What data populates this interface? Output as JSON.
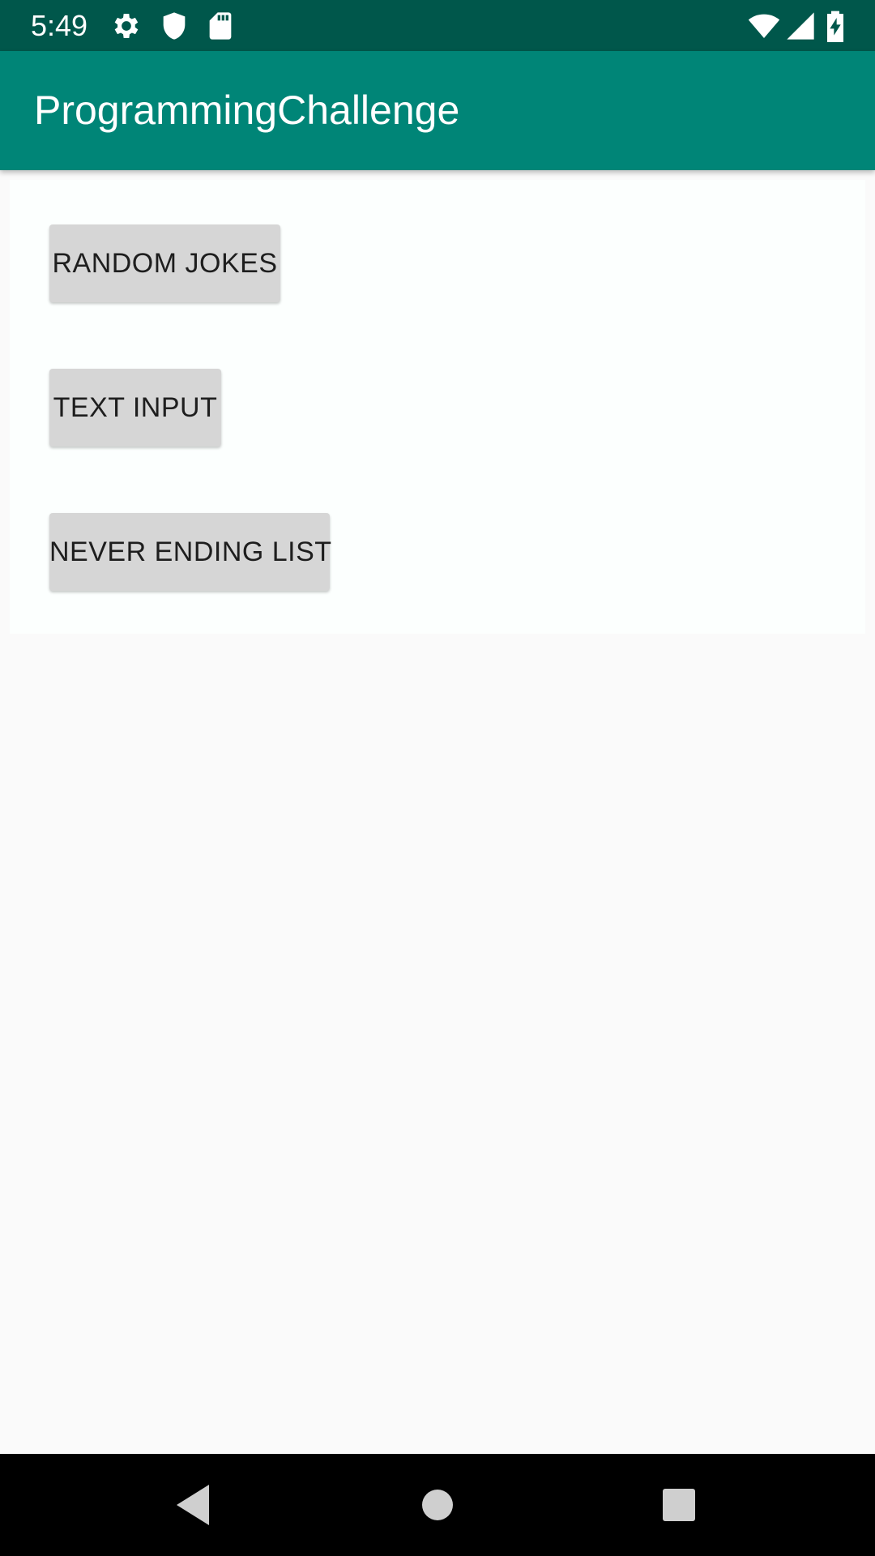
{
  "status_bar": {
    "time": "5:49",
    "left_icons": [
      "gear-icon",
      "shield-icon",
      "sd-card-icon"
    ],
    "right_icons": [
      "wifi-icon",
      "signal-icon",
      "battery-charging-icon"
    ],
    "background": "#00574b"
  },
  "app_bar": {
    "title": "ProgrammingChallenge",
    "background": "#008577"
  },
  "buttons": {
    "random_jokes": "RANDOM JOKES",
    "text_input": "TEXT INPUT",
    "never_ending_list": "NEVER ENDING LIST"
  },
  "nav_bar": {
    "icons": [
      "back-icon",
      "home-icon",
      "recents-icon"
    ]
  }
}
